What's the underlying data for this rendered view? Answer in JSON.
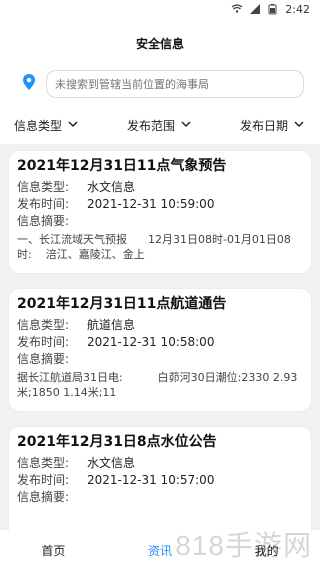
{
  "statusbar": {
    "time": "2:42",
    "wifi_icon": "wifi-icon",
    "battery_icon": "battery-icon",
    "signal_icon": "signal-icon"
  },
  "header": {
    "title": "安全信息"
  },
  "search": {
    "placeholder": "未搜索到管辖当前位置的海事局",
    "icon": "location-pin-icon",
    "accent": "#1e90ff"
  },
  "filters": [
    {
      "label": "信息类型"
    },
    {
      "label": "发布范围"
    },
    {
      "label": "发布日期"
    }
  ],
  "cards": [
    {
      "title": "2021年12月31日11点气象预告",
      "type_label": "信息类型:",
      "type_value": "水文信息",
      "time_label": "发布时间:",
      "time_value": "2021-12-31 10:59:00",
      "summary_label": "信息摘要:",
      "summary_value": "一、长江流域天气预报      12月31日08时-01月01日08时:    涪江、嘉陵江、金上"
    },
    {
      "title": "2021年12月31日11点航道通告",
      "type_label": "信息类型:",
      "type_value": "航道信息",
      "time_label": "发布时间:",
      "time_value": "2021-12-31 10:58:00",
      "summary_label": "信息摘要:",
      "summary_value": "据长江航道局31日电:          白茆河30日潮位:2330 2.93米;1850 1.14米;11"
    },
    {
      "title": "2021年12月31日8点水位公告",
      "type_label": "信息类型:",
      "type_value": "水文信息",
      "time_label": "发布时间:",
      "time_value": "2021-12-31 10:57:00",
      "summary_label": "信息摘要:",
      "summary_value": ""
    }
  ],
  "bottom_nav": [
    {
      "label": "首页"
    },
    {
      "label": "资讯"
    },
    {
      "label": "我的"
    }
  ],
  "watermark": "818手游网"
}
